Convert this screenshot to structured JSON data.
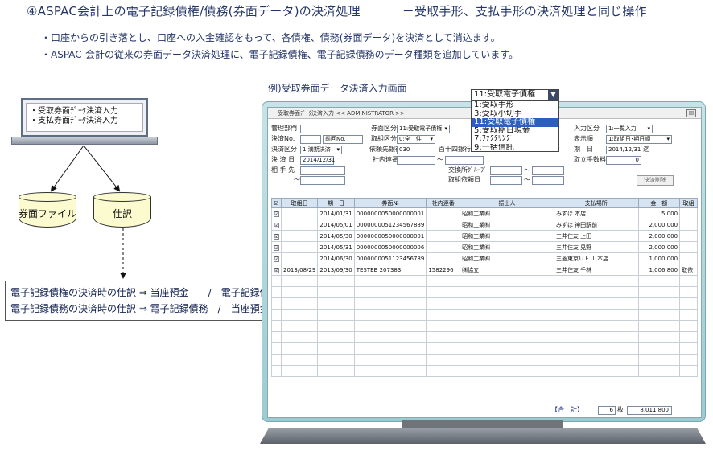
{
  "heading": {
    "main": "④ASPAC会計上の電子記録債権/債務(券面データ)の決済処理",
    "sub": "－受取手形、支払手形の決済処理と同じ操作"
  },
  "bullets": [
    "・口座からの引き落とし、口座への入金確認をもって、各債権、債務(券面データ)を決済として消込ます。",
    "・ASPAC-会計の従来の券面データ決済処理に、電子記録債権、電子記録債務のデータ種類を追加しています。"
  ],
  "laptop_menu": [
    "・受取券面ﾃﾞｰﾀ決済入力",
    "・支払券面ﾃﾞｰﾀ決済入力"
  ],
  "cylinders": {
    "left": "券面ファイル",
    "right": "仕訳"
  },
  "journal_lines": [
    "電子記録債権の決済時の仕訳 ⇒ 当座預金　　/　電子記録債権",
    "電子記録債務の決済時の仕訳 ⇒ 電子記録債務　/　当座預金"
  ],
  "example_caption": "例)受取券面データ決済入力画面",
  "dropdown": {
    "selected": "11:受取電子債権",
    "options": [
      "1:受取手形",
      "3:受取小切手",
      "11:受取電子債権",
      "5:受取期日現金",
      "7:ﾌｧｸﾀﾘﾝｸﾞ",
      "9:一括信託"
    ],
    "highlight_index": 2
  },
  "window": {
    "title": "受取券面ﾃﾞｰﾀ決済入力 << ADMINISTRATOR >>",
    "close": "☒",
    "form": {
      "dept_label": "管理部門",
      "slip_label": "決済No.",
      "slip_prev": "前回No.",
      "kbn_label": "決済区分",
      "kbn_value": "1:満期決済",
      "date_label": "決 済 日",
      "date_value": "2014/12/31",
      "partner_label": "相 手 先",
      "tilde": "～",
      "kenmen_label": "券面区分",
      "kenmen_value": "11:受取電子債権",
      "torikumi_label": "取組区分",
      "torikumi_value": "0:全　件",
      "bank_label": "依頼先銀行",
      "bank_code": "030",
      "bank_name": "百十四銀行 県庁東部支店 普",
      "inner_label": "社内連番",
      "exch_label": "交換所ｸﾞﾙｰﾌﾟ",
      "req_date_label": "取組依頼日",
      "input_kbn_label": "入力区分",
      "input_kbn_value": "1:一覧入力",
      "order_label": "表示順",
      "order_value": "1:取組日･期日順",
      "kijitsu_label": "期　日",
      "kijitsu_value": "2014/12/31",
      "kijitsu_suffix": "迄",
      "fee_label": "取立手数料",
      "fee_value": "0",
      "delete_btn": "決済削除"
    },
    "grid": {
      "headers": [
        "☑",
        "取組日",
        "期　日",
        "券面№",
        "社内連番",
        "振出人",
        "支払場所",
        "金　額",
        "取組"
      ],
      "rows": [
        [
          "☑",
          "",
          "2014/01/31",
          "0000000050000000001",
          "",
          "昭和工業㈱",
          "みずほ 本店",
          "5,000",
          ""
        ],
        [
          "☑",
          "",
          "2014/05/01",
          "0000000051234567889",
          "",
          "昭和工業㈱",
          "みずほ 神田駅前",
          "2,000,000",
          ""
        ],
        [
          "☑",
          "",
          "2014/05/30",
          "0000000050000000001",
          "",
          "昭和工業㈱",
          "三井住友 上田",
          "2,000,000",
          ""
        ],
        [
          "☑",
          "",
          "2014/05/31",
          "0000000050000000006",
          "",
          "昭和工業㈱",
          "三井住友 見野",
          "2,000,000",
          ""
        ],
        [
          "☑",
          "",
          "2014/06/30",
          "0000000051123456789",
          "",
          "昭和工業㈱",
          "三菱東京ＵＦＪ 本店",
          "1,000,000",
          ""
        ],
        [
          "☑",
          "2013/08/29",
          "2013/09/30",
          "TESTEB 207383",
          "1582296",
          "㈱協立",
          "三井住友 千林",
          "1,006,800",
          "取依"
        ]
      ],
      "empty_rows": 9
    },
    "footer": {
      "total_label": "【合　計】",
      "count": "6",
      "count_unit": "枚",
      "amount": "8,011,800"
    }
  }
}
